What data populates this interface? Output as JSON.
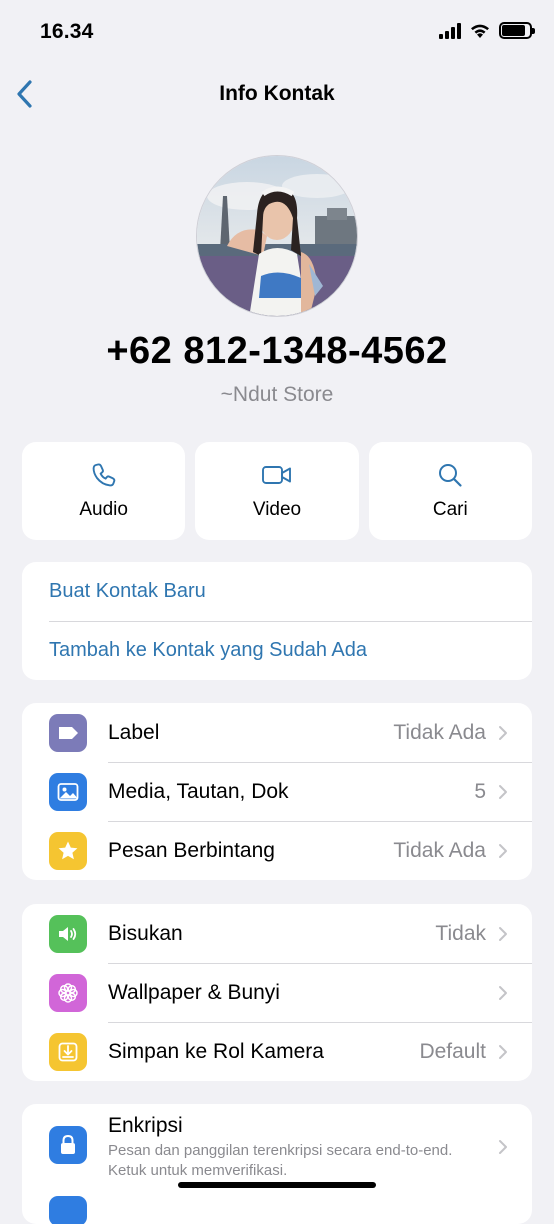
{
  "status": {
    "time": "16.34"
  },
  "nav": {
    "title": "Info Kontak"
  },
  "contact": {
    "phone": "+62 812-1348-4562",
    "name": "~Ndut Store"
  },
  "actions": [
    {
      "label": "Audio",
      "icon": "phone-icon"
    },
    {
      "label": "Video",
      "icon": "video-icon"
    },
    {
      "label": "Cari",
      "icon": "search-icon"
    }
  ],
  "links": [
    {
      "label": "Buat Kontak Baru"
    },
    {
      "label": "Tambah ke Kontak yang Sudah Ada"
    }
  ],
  "group1": [
    {
      "label": "Label",
      "value": "Tidak Ada",
      "icon": "label-tag-icon",
      "color": "#7c7bb8"
    },
    {
      "label": "Media, Tautan, Dok",
      "value": "5",
      "icon": "photo-icon",
      "color": "#2f7de1"
    },
    {
      "label": "Pesan Berbintang",
      "value": "Tidak Ada",
      "icon": "star-icon",
      "color": "#f5c531"
    }
  ],
  "group2": [
    {
      "label": "Bisukan",
      "value": "Tidak",
      "icon": "speaker-icon",
      "color": "#55c15a"
    },
    {
      "label": "Wallpaper & Bunyi",
      "value": "",
      "icon": "flower-icon",
      "color": "#d166d8"
    },
    {
      "label": "Simpan ke Rol Kamera",
      "value": "Default",
      "icon": "download-icon",
      "color": "#f5c531"
    }
  ],
  "encryption": {
    "title": "Enkripsi",
    "desc": "Pesan dan panggilan terenkripsi secara end-to-end. Ketuk untuk memverifikasi.",
    "icon": "lock-icon",
    "color": "#2f7de1"
  },
  "colors": {
    "accent": "#2f76b0",
    "background": "#f1f1f5"
  }
}
